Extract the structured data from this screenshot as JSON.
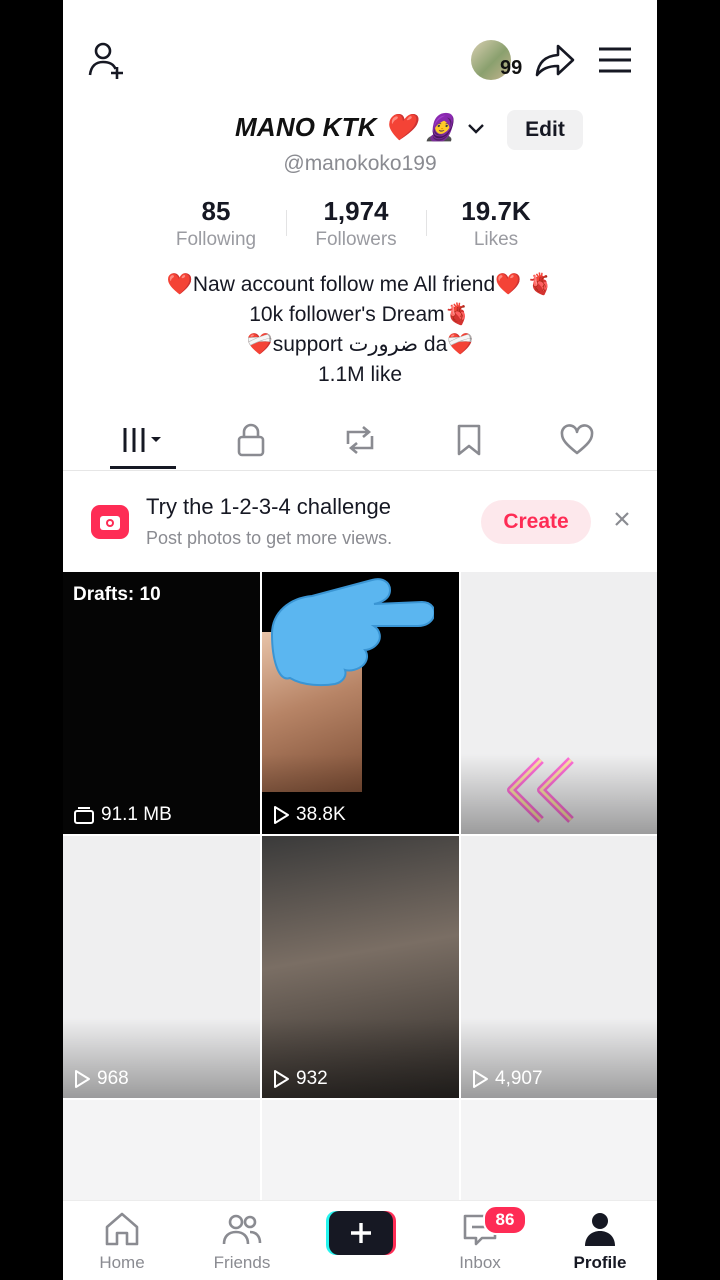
{
  "header": {
    "add_friend_icon": "person-plus-icon",
    "avatar_count": "99",
    "share_icon": "share-arrow-icon",
    "menu_icon": "hamburger-menu-icon"
  },
  "profile": {
    "display_name": "MANO KTK ❤️ 🧕",
    "handle": "@manokoko199",
    "edit_label": "Edit",
    "stats": [
      {
        "value": "85",
        "label": "Following"
      },
      {
        "value": "1,974",
        "label": "Followers"
      },
      {
        "value": "19.7K",
        "label": "Likes"
      }
    ],
    "bio_lines": [
      "❤️Naw account follow me All friend❤️ 🫀",
      "10k follower's Dream🫀",
      "❤️‍🩹support ضرورت da❤️‍🩹",
      "1.1M like"
    ]
  },
  "tabs": [
    "videos",
    "private",
    "reposts",
    "favorites",
    "liked"
  ],
  "banner": {
    "title": "Try the 1-2-3-4 challenge",
    "subtitle": "Post photos to get more views.",
    "create_label": "Create",
    "close_icon": "close-icon"
  },
  "grid": {
    "drafts_label": "Drafts: 10",
    "items": [
      {
        "label": "91.1 MB",
        "kind": "drafts"
      },
      {
        "label": "38.8K",
        "kind": "video"
      },
      {
        "label": "",
        "kind": "video"
      },
      {
        "label": "968",
        "kind": "video"
      },
      {
        "label": "932",
        "kind": "video"
      },
      {
        "label": "4,907",
        "kind": "video"
      }
    ]
  },
  "bottom_nav": {
    "home": "Home",
    "friends": "Friends",
    "inbox": "Inbox",
    "inbox_badge": "86",
    "profile": "Profile"
  },
  "colors": {
    "accent": "#fe2c55",
    "text": "#161823",
    "muted": "#8a8b91"
  }
}
